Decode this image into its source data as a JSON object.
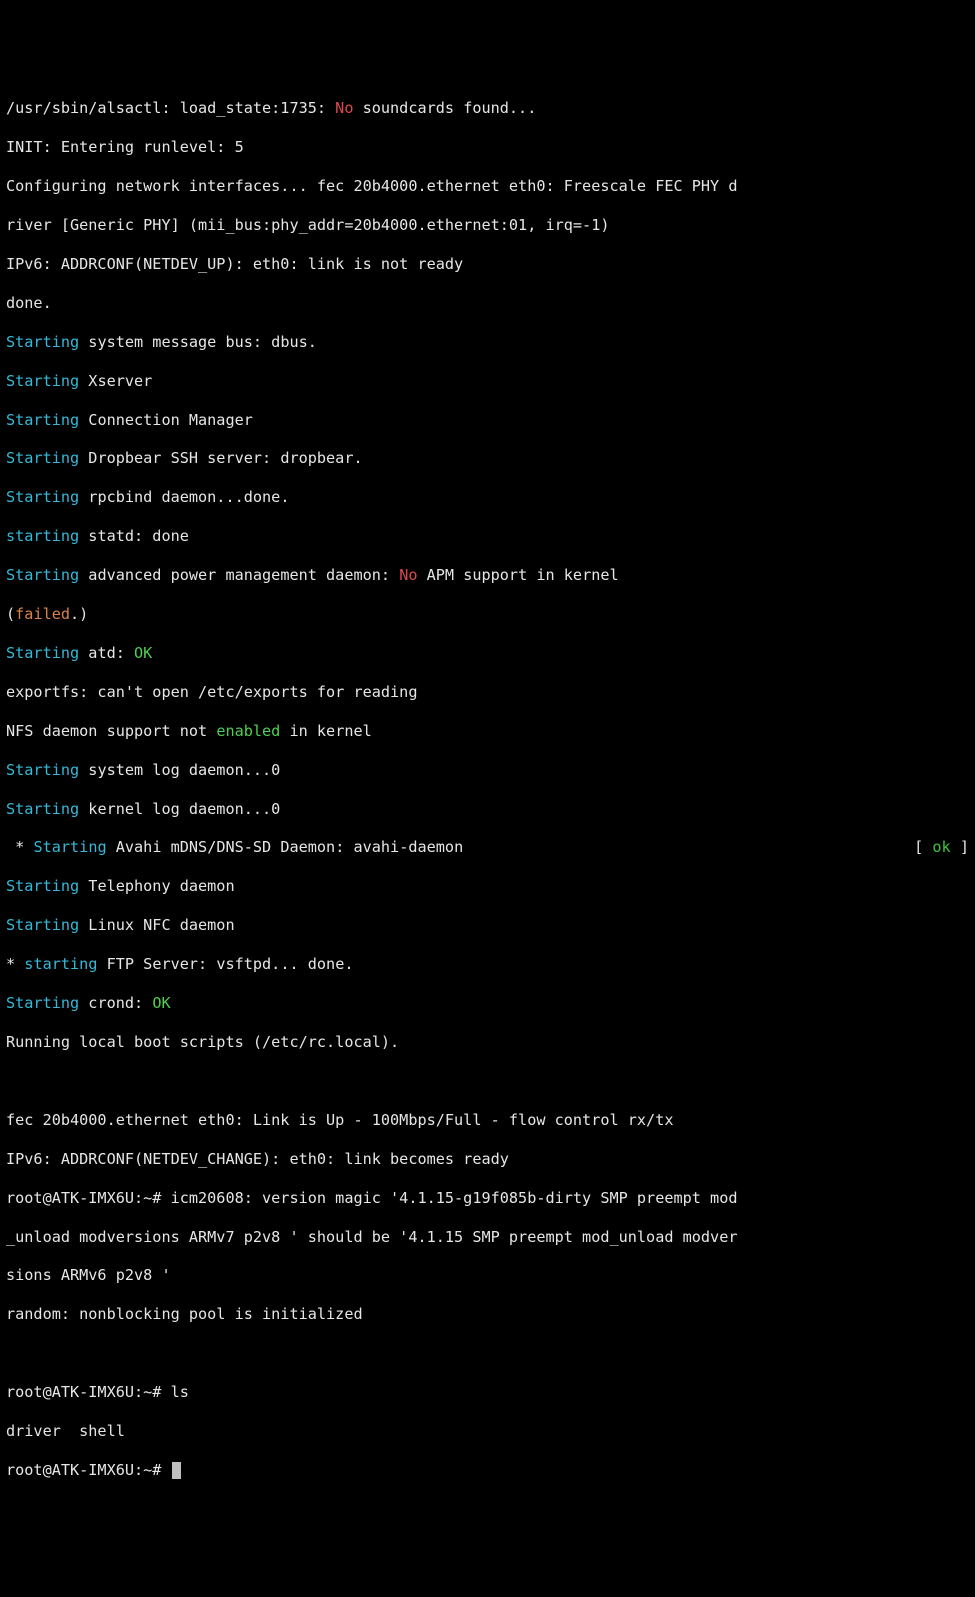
{
  "l1a": "/usr/sbin/alsactl: load_state:1735: ",
  "l1b": "No",
  "l1c": " soundcards found...",
  "l2": "INIT: Entering runlevel: 5",
  "l3": "Configuring network interfaces... fec 20b4000.ethernet eth0: Freescale FEC PHY d",
  "l4": "river [Generic PHY] (mii_bus:phy_addr=20b4000.ethernet:01, irq=-1)",
  "l5": "IPv6: ADDRCONF(NETDEV_UP): eth0: link is not ready",
  "l6": "done.",
  "l7a": "Starting",
  "l7b": " system message bus: dbus.",
  "l8a": "Starting",
  "l8b": " Xserver",
  "l9a": "Starting",
  "l9b": " Connection Manager",
  "l10a": "Starting",
  "l10b": " Dropbear SSH server: dropbear.",
  "l11a": "Starting",
  "l11b": " rpcbind daemon...done.",
  "l12a": "starting",
  "l12b": " statd: done",
  "l13a": "Starting",
  "l13b": " advanced power management daemon: ",
  "l13c": "No",
  "l13d": " APM support in kernel",
  "l14a": "(",
  "l14b": "failed",
  "l14c": ".)",
  "l15a": "Starting",
  "l15b": " atd: ",
  "l15c": "OK",
  "l16": "exportfs: can't open /etc/exports for reading",
  "l17a": "NFS daemon support not ",
  "l17b": "enabled",
  "l17c": " in kernel",
  "l18a": "Starting",
  "l18b": " system log daemon...0",
  "l19a": "Starting",
  "l19b": " kernel log daemon...0",
  "l20a": " * ",
  "l20b": "Starting",
  "l20c": " Avahi mDNS/DNS-SD Daemon: avahi-daemon",
  "l20d": "[ ",
  "l20e": "ok",
  "l20f": " ]",
  "l21a": "Starting",
  "l21b": " Telephony daemon",
  "l22a": "Starting",
  "l22b": " Linux NFC daemon",
  "l23a": "* ",
  "l23b": "starting",
  "l23c": " FTP Server: vsftpd... done.",
  "l24a": "Starting",
  "l24b": " crond: ",
  "l24c": "OK",
  "l25": "Running local boot scripts (/etc/rc.local).",
  "l26": " ",
  "l27": "fec 20b4000.ethernet eth0: Link is Up - 100Mbps/Full - flow control rx/tx",
  "l28": "IPv6: ADDRCONF(NETDEV_CHANGE): eth0: link becomes ready",
  "l29": "root@ATK-IMX6U:~# icm20608: version magic '4.1.15-g19f085b-dirty SMP preempt mod",
  "l30": "_unload modversions ARMv7 p2v8 ' should be '4.1.15 SMP preempt mod_unload modver",
  "l31": "sions ARMv6 p2v8 '",
  "l32": "random: nonblocking pool is initialized",
  "l33": " ",
  "l34p": "root@ATK-IMX6U:~# ",
  "l34c": "ls",
  "l35": "driver  shell",
  "l36p": "root@ATK-IMX6U:~# "
}
